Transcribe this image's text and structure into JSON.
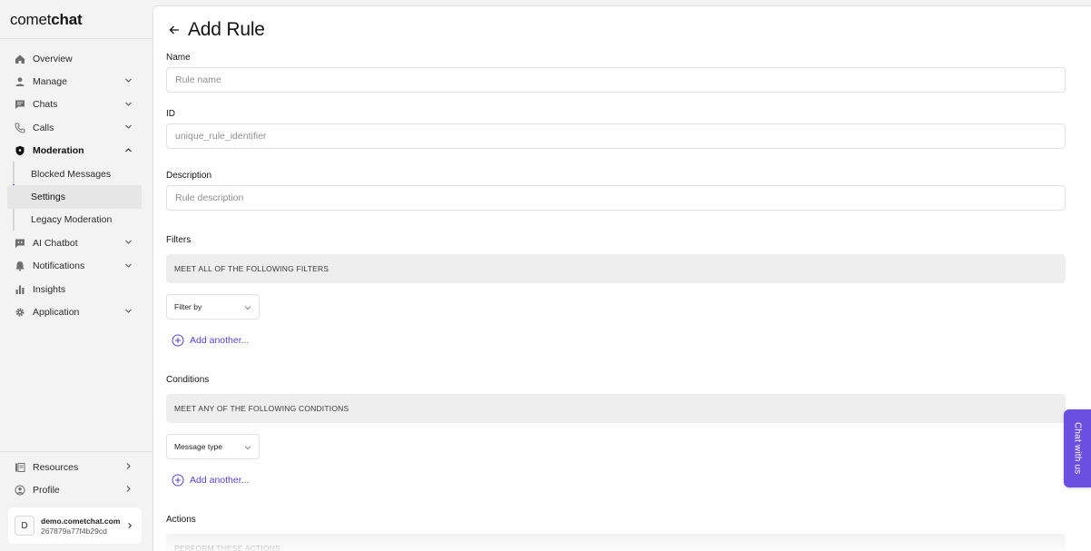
{
  "brand": {
    "light": "comet",
    "bold": "chat"
  },
  "sidebar": {
    "items": [
      {
        "label": "Overview",
        "icon": "home-icon",
        "chevron": "none"
      },
      {
        "label": "Manage",
        "icon": "user-icon",
        "chevron": "down"
      },
      {
        "label": "Chats",
        "icon": "chat-icon",
        "chevron": "down"
      },
      {
        "label": "Calls",
        "icon": "phone-icon",
        "chevron": "down"
      },
      {
        "label": "Moderation",
        "icon": "shield-icon",
        "chevron": "up"
      },
      {
        "label": "Blocked Messages"
      },
      {
        "label": "Settings"
      },
      {
        "label": "Legacy Moderation"
      },
      {
        "label": "AI Chatbot",
        "icon": "bot-icon",
        "chevron": "down"
      },
      {
        "label": "Notifications",
        "icon": "bell-icon",
        "chevron": "down"
      },
      {
        "label": "Insights",
        "icon": "bar-chart-icon",
        "chevron": "none"
      },
      {
        "label": "Application",
        "icon": "gear-icon",
        "chevron": "down"
      }
    ],
    "bottom_items": [
      {
        "label": "Resources",
        "icon": "book-icon",
        "chevron": "right"
      },
      {
        "label": "Profile",
        "icon": "profile-icon",
        "chevron": "right"
      }
    ],
    "account": {
      "initial": "D",
      "domain": "demo.cometchat.com",
      "app_id": "267879a77f4b29cd"
    }
  },
  "page": {
    "title": "Add Rule",
    "name_label": "Name",
    "name_placeholder": "Rule name",
    "id_label": "ID",
    "id_placeholder": "unique_rule_identifier",
    "description_label": "Description",
    "description_placeholder": "Rule description",
    "filters_label": "Filters",
    "filters_bar": "MEET ALL OF THE FOLLOWING FILTERS",
    "filter_select": "Filter by",
    "filters_add": "Add another...",
    "conditions_label": "Conditions",
    "conditions_bar": "MEET ANY OF THE FOLLOWING CONDITIONS",
    "condition_select": "Message type",
    "conditions_add": "Add another...",
    "actions_label": "Actions",
    "actions_bar": "PERFORM THESE ACTIONS"
  },
  "chat_widget": {
    "label": "Chat with us"
  },
  "colors": {
    "accent": "#6b4fe0",
    "link": "#5b3fd6",
    "sidebar_bg": "#f3f3f3",
    "bar_bg": "#eeeeee"
  }
}
